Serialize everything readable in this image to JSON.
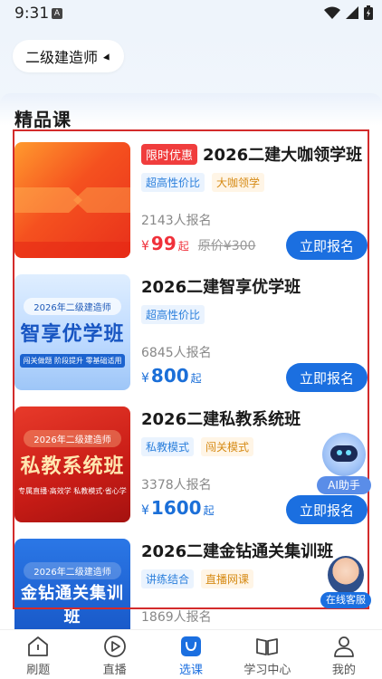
{
  "status_bar": {
    "time": "9:31",
    "notification_badge": "A"
  },
  "header": {
    "exam_selector": "二级建造师"
  },
  "section": {
    "title": "精品课"
  },
  "courses": [
    {
      "badge": "限时优惠",
      "title": "2026二建大咖领学班",
      "tags": [
        {
          "text": "超高性价比",
          "style": "blue"
        },
        {
          "text": "大咖领学",
          "style": "orange"
        }
      ],
      "enrolled": "2143人报名",
      "price_symbol": "¥",
      "price": "99",
      "price_suffix": "起",
      "original_price": "原价¥300",
      "button": "立即报名",
      "thumb": {
        "small": "",
        "big": "",
        "sub": ""
      }
    },
    {
      "badge": "",
      "title": "2026二建智享优学班",
      "tags": [
        {
          "text": "超高性价比",
          "style": "blue"
        }
      ],
      "enrolled": "6845人报名",
      "price_symbol": "¥",
      "price": "800",
      "price_suffix": "起",
      "original_price": "",
      "button": "立即报名",
      "thumb": {
        "small": "2026年二级建造师",
        "big": "智享优学班",
        "sub": "闯关做题  阶段提升  零基础适用"
      }
    },
    {
      "badge": "",
      "title": "2026二建私教系统班",
      "tags": [
        {
          "text": "私教模式",
          "style": "blue"
        },
        {
          "text": "闯关模式",
          "style": "orange"
        }
      ],
      "enrolled": "3378人报名",
      "price_symbol": "¥",
      "price": "1600",
      "price_suffix": "起",
      "original_price": "",
      "button": "立即报名",
      "thumb": {
        "small": "2026年二级建造师",
        "big": "私教系统班",
        "sub": "专属直播·高效学   私教模式·省心学"
      }
    },
    {
      "badge": "",
      "title": "2026二建金钻通关集训班",
      "tags": [
        {
          "text": "讲练结合",
          "style": "blue"
        },
        {
          "text": "直播网课",
          "style": "orange"
        }
      ],
      "enrolled": "1869人报名",
      "price_symbol": "¥",
      "price": "",
      "price_suffix": "",
      "original_price": "",
      "button": "",
      "thumb": {
        "small": "2026年二级建造师",
        "big": "金钻通关集训班",
        "sub": ""
      }
    }
  ],
  "floating": {
    "ai_helper": "AI助手",
    "customer_service": "在线客服"
  },
  "bottom_nav": [
    {
      "label": "刷题",
      "icon": "home-icon"
    },
    {
      "label": "直播",
      "icon": "play-icon"
    },
    {
      "label": "选课",
      "icon": "bag-icon",
      "active": true
    },
    {
      "label": "学习中心",
      "icon": "book-icon"
    },
    {
      "label": "我的",
      "icon": "user-icon"
    }
  ],
  "colors": {
    "accent": "#1b6fe0",
    "price_red": "#f0303a",
    "highlight_border": "#d32b2b"
  }
}
